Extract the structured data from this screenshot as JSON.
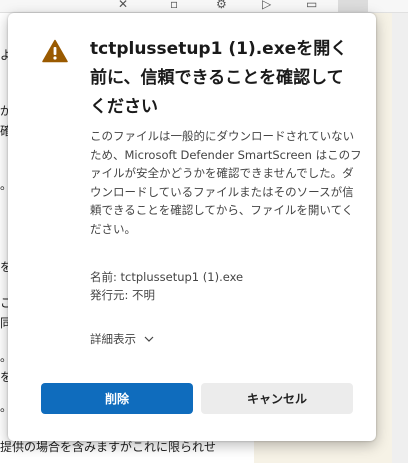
{
  "background": {
    "lines": [
      "よび",
      "がで",
      "確",
      "。",
      "をき",
      "こと",
      "同封",
      "。",
      "を行",
      "。",
      "提供の場合を含みますがこれに限られせ"
    ]
  },
  "dialog": {
    "title": "tctplussetup1 (1).exeを開く前に、信頼できることを確認してください",
    "body": "このファイルは一般的にダウンロードされていないため、Microsoft Defender SmartScreen はこのファイルが安全かどうかを確認できませんでした。ダウンロードしているファイルまたはそのソースが信頼できることを確認してから、ファイルを開いてください。",
    "name_line": "名前: tctplussetup1 (1).exe",
    "publisher_line": "発行元: 不明",
    "details_label": "詳細表示",
    "delete_label": "削除",
    "cancel_label": "キャンセル"
  },
  "colors": {
    "primary": "#0f6cbd",
    "warning": "#9a5a00"
  }
}
